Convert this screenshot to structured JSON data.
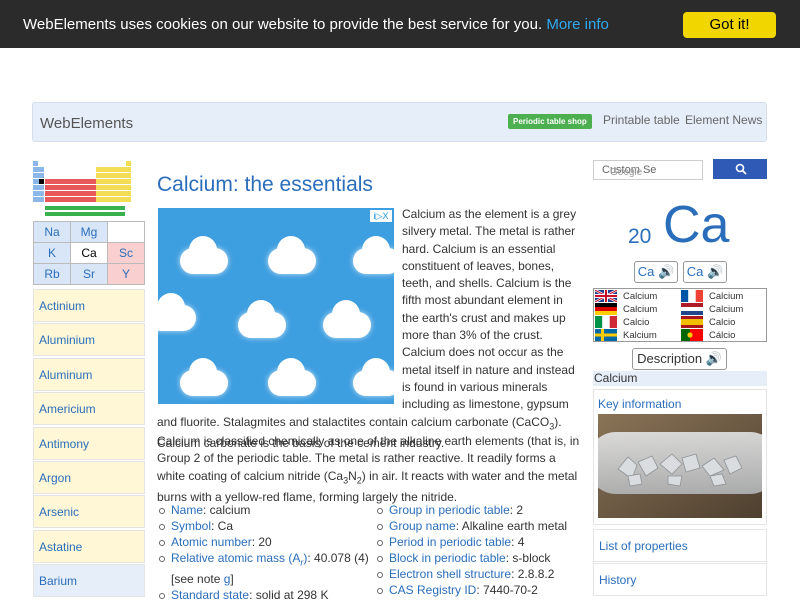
{
  "cookie": {
    "message": "WebElements uses cookies on our website to provide the best service for you.",
    "more_info": "More info",
    "got_it": "Got it!"
  },
  "topbar": {
    "brand": "WebElements",
    "shop": "Periodic table shop",
    "printable": "Printable table",
    "news": "Element News"
  },
  "neighbors": [
    [
      "Na",
      "Mg",
      ""
    ],
    [
      "K",
      "Ca",
      "Sc"
    ],
    [
      "Rb",
      "Sr",
      "Y"
    ]
  ],
  "element_list": [
    "Actinium",
    "Aluminium",
    "Aluminum",
    "Americium",
    "Antimony",
    "Argon",
    "Arsenic",
    "Astatine",
    "Barium"
  ],
  "element_list_colors": [
    "#fff7d6",
    "#fff7d6",
    "#fff7d6",
    "#fff7d6",
    "#fff7d6",
    "#fff7d6",
    "#fff7d6",
    "#fff7d6",
    "#e6eef9"
  ],
  "main": {
    "title": "Calcium: the essentials",
    "intro": "Calcium as the element is a grey silvery metal. The metal is rather hard. Calcium is an essential constituent of leaves, bones, teeth, and shells. Calcium is the fifth most abundant element in the earth's crust and makes up more than 3% of the crust. Calcium does not occur as the metal itself in nature and instead is found in various minerals including as limestone, gypsum and fluorite. Stalagmites and stalactites contain calcium carbonate (CaCO",
    "intro_sub": "3",
    "intro_end": "). Calcium carbonate is the basis of the cement industry.",
    "para2_a": "Calcium is classified chemically as one of the alkaline earth elements (that is, in Group 2 of the periodic table. The metal is rather reactive. It readily forms a white coating of calcium nitride (Ca",
    "para2_s1": "3",
    "para2_b": "N",
    "para2_s2": "2",
    "para2_c": ") in air. It reacts with water and the metal burns with a yellow-red flame, forming largely the nitride.",
    "ad_tag": "i▷X"
  },
  "facts_left": [
    {
      "label": "Name",
      "value": ": calcium"
    },
    {
      "label": "Symbol",
      "value": ": Ca"
    },
    {
      "label": "Atomic number",
      "value": ": 20"
    },
    {
      "label": "Relative atomic mass (A",
      "sub": "r",
      "label_end": ")",
      "value": ": 40.078 (4)"
    },
    {
      "cont": "[see note ",
      "link": "g",
      "end": "]"
    },
    {
      "label": "Standard state",
      "value": ": solid at 298 K"
    }
  ],
  "facts_right": [
    {
      "label": "Group in periodic table",
      "value": ": 2"
    },
    {
      "label": "Group name",
      "value": ": Alkaline earth metal"
    },
    {
      "label": "Period in periodic table",
      "value": ": 4"
    },
    {
      "label": "Block in periodic table",
      "value": ": s-block"
    },
    {
      "label": "Electron shell structure",
      "value": ": 2.8.8.2"
    },
    {
      "label": "CAS Registry ID",
      "value": ": 7440-70-2"
    }
  ],
  "search": {
    "placeholder": "Custom Se",
    "google": "Google"
  },
  "element": {
    "number": "20",
    "symbol": "Ca"
  },
  "sound_buttons": [
    "Ca 🔊",
    "Ca 🔊"
  ],
  "languages": [
    {
      "name": "Calcium",
      "flag": "uk"
    },
    {
      "name": "Calcium",
      "flag": "fr"
    },
    {
      "name": "Calcium",
      "flag": "de"
    },
    {
      "name": "Calcium",
      "flag": "nl"
    },
    {
      "name": "Calcio",
      "flag": "it"
    },
    {
      "name": "Calcio",
      "flag": "es"
    },
    {
      "name": "Kalcium",
      "flag": "se"
    },
    {
      "name": "Cálcio",
      "flag": "pt"
    }
  ],
  "description_button": "Description 🔊",
  "right": {
    "title": "Calcium",
    "key_info": "Key information",
    "properties": "List of properties",
    "history": "History"
  },
  "colors": {
    "link": "#2a6ebb",
    "cookie_bg": "#2b2b2b",
    "got_it_bg": "#f1d600"
  }
}
